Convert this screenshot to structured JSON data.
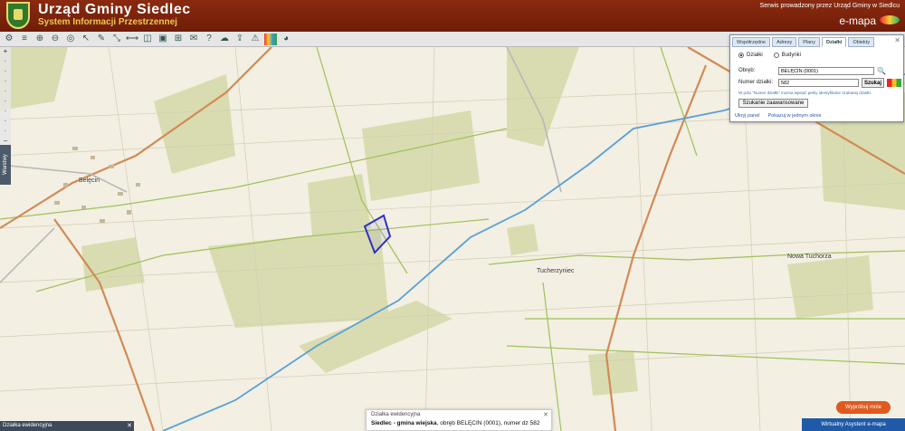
{
  "header": {
    "title": "Urząd Gminy Siedlec",
    "subtitle": "System Informacji Przestrzennej",
    "service": "Serwis prowadzony przez Urząd Gminy w Siedlcu",
    "brand": "e-mapa"
  },
  "toolbar": {
    "icons": [
      "map-icon",
      "layers-icon",
      "zoom-in-icon",
      "zoom-out-icon",
      "zoom-extent-icon",
      "pan-icon",
      "pointer-icon",
      "pencil-icon",
      "measure-distance-icon",
      "measure-area-icon",
      "compare-icon",
      "print-icon",
      "coordinates-icon",
      "comment-icon",
      "help-icon",
      "cloud-icon",
      "upload-icon",
      "warning-icon",
      "palette-icon",
      "paint-icon"
    ]
  },
  "sidebar": {
    "warstwy": "Warstwy"
  },
  "search_panel": {
    "tabs": [
      "Współrzędne",
      "Adresy",
      "Plany",
      "Działki",
      "Obiekty"
    ],
    "active_tab": "Działki",
    "radio_dzialki": "Działki",
    "radio_budynki": "Budynki",
    "obreb_label": "Obręb:",
    "obreb_value": "BELĘCIN (0001)",
    "numer_label": "Numer działki:",
    "numer_value": "582",
    "szukaj": "Szukaj",
    "hint": "W polu \"Numer działki\" można wpisać pełny identyfikator szukanej działki.",
    "advanced": "Szukanie zaawansowane",
    "link_hide": "Ukryj panel",
    "link_window": "Pokazuj w jednym oknie"
  },
  "map": {
    "labels": [
      "Belęcin",
      "Tucherzyniec",
      "Nowa Tuchorza"
    ]
  },
  "info_popup": {
    "title": "Działka ewidencyjna",
    "text_bold": "Siedlec - gmina wiejska",
    "text_rest": ", obręb BELĘCIN (0001), numer dz 582"
  },
  "bottom": {
    "ewid": "Działka ewidencyjna",
    "wyprobuj": "Wypróbuj mnie",
    "asystent": "Wirtualny Asystent e-mapa"
  },
  "colors": {
    "header": "#7a2310",
    "accent": "#1e5aa8",
    "highlight": "#3030c8"
  }
}
